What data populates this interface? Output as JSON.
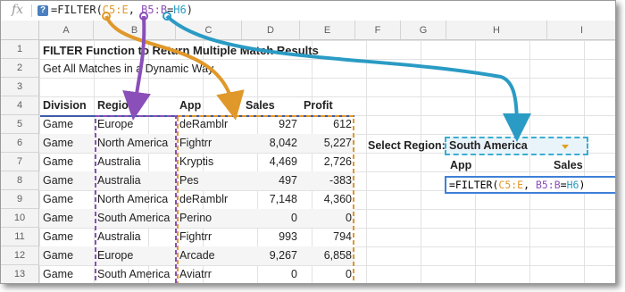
{
  "formula_bar": {
    "fx_label": "fx",
    "help_label": "?",
    "formula_parts": [
      {
        "text": "=FILTER(",
        "color": "default"
      },
      {
        "text": "C5:E",
        "color": "orange"
      },
      {
        "text": ", ",
        "color": "default"
      },
      {
        "text": "B5:B",
        "color": "purple"
      },
      {
        "text": "=",
        "color": "default"
      },
      {
        "text": "H6",
        "color": "blue"
      },
      {
        "text": ")",
        "color": "default"
      }
    ]
  },
  "columns": [
    "A",
    "B",
    "C",
    "D",
    "E",
    "F",
    "G",
    "H",
    "I"
  ],
  "rows": [
    "1",
    "2",
    "3",
    "4",
    "5",
    "6",
    "7",
    "8",
    "9",
    "10",
    "11",
    "12",
    "13"
  ],
  "sheet": {
    "title": "FILTER Function to Return Multiple Match Results",
    "subtitle": "Get All Matches in a Dynamic Way",
    "headers": [
      "Division",
      "Region",
      "App",
      "Sales",
      "Profit"
    ],
    "data": [
      [
        "Game",
        "Europe",
        "deRamblr",
        "927",
        "612"
      ],
      [
        "Game",
        "North America",
        "Fightrr",
        "8,042",
        "5,227"
      ],
      [
        "Game",
        "Australia",
        "Kryptis",
        "4,469",
        "2,726"
      ],
      [
        "Game",
        "Australia",
        "Pes",
        "497",
        "-383"
      ],
      [
        "Game",
        "North America",
        "deRamblr",
        "7,148",
        "4,360"
      ],
      [
        "Game",
        "South America",
        "Perino",
        "0",
        "0"
      ],
      [
        "Game",
        "Australia",
        "Fightrr",
        "993",
        "794"
      ],
      [
        "Game",
        "Europe",
        "Arcade",
        "9,267",
        "6,858"
      ],
      [
        "Game",
        "South America",
        "Aviatrr",
        "0",
        "0"
      ]
    ]
  },
  "lookup": {
    "select_label": "Select Region:",
    "select_value": "South America",
    "result_headers": [
      "App",
      "Sales"
    ],
    "editing_formula": "=FILTER(C5:E, B5:B=H6)"
  },
  "colors": {
    "orange": "#e0982a",
    "purple": "#8a4fb8",
    "blue": "#2a9bc4",
    "header_rule": "#3d5ba8"
  }
}
